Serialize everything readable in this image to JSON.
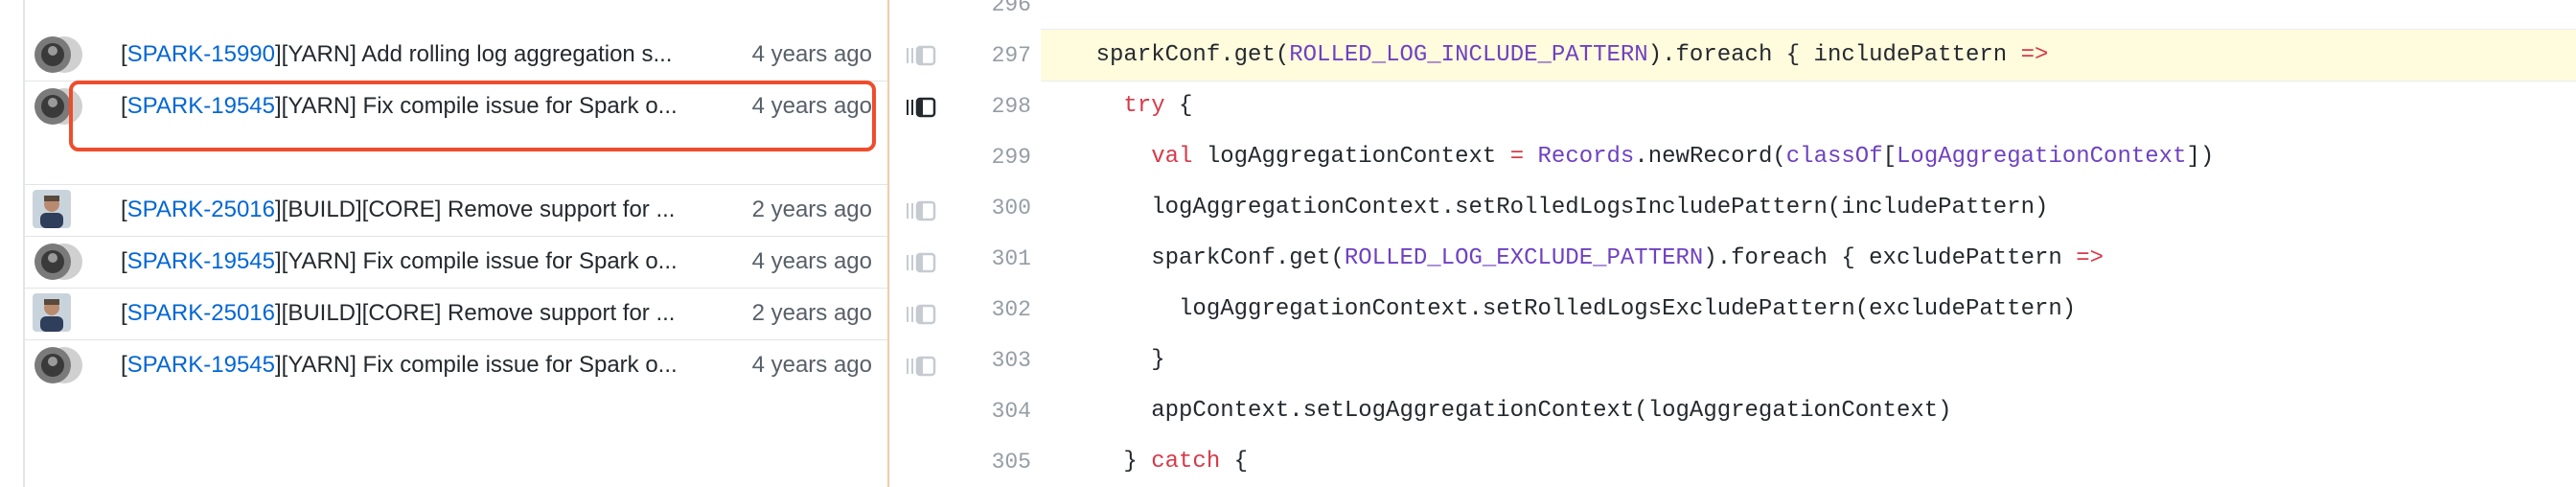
{
  "blame": {
    "rows": [
      {
        "avatar": "avatar-gray",
        "ref": "SPARK-15990",
        "msg": "[YARN] Add rolling log aggregation s...",
        "age": "4 years ago"
      },
      {
        "avatar": "avatar-gray",
        "ref": "SPARK-19545",
        "msg": "[YARN] Fix compile issue for Spark o...",
        "age": "4 years ago"
      },
      {
        "avatar": "avatar-photo",
        "ref": "SPARK-25016",
        "msg": "[BUILD][CORE] Remove support for ...",
        "age": "2 years ago"
      },
      {
        "avatar": "avatar-gray",
        "ref": "SPARK-19545",
        "msg": "[YARN] Fix compile issue for Spark o...",
        "age": "4 years ago"
      },
      {
        "avatar": "avatar-photo",
        "ref": "SPARK-25016",
        "msg": "[BUILD][CORE] Remove support for ...",
        "age": "2 years ago"
      },
      {
        "avatar": "avatar-gray",
        "ref": "SPARK-19545",
        "msg": "[YARN] Fix compile issue for Spark o...",
        "age": "4 years ago"
      }
    ]
  },
  "code": {
    "line_numbers": [
      "296",
      "297",
      "298",
      "299",
      "300",
      "301",
      "302",
      "303",
      "304",
      "305"
    ],
    "lines": [
      "",
      "    sparkConf.get(ROLLED_LOG_INCLUDE_PATTERN).foreach { includePattern =>",
      "      try {",
      "        val logAggregationContext = Records.newRecord(classOf[LogAggregationContext])",
      "        logAggregationContext.setRolledLogsIncludePattern(includePattern)",
      "        sparkConf.get(ROLLED_LOG_EXCLUDE_PATTERN).foreach { excludePattern =>",
      "          logAggregationContext.setRolledLogsExcludePattern(excludePattern)",
      "        }",
      "        appContext.setLogAggregationContext(logAggregationContext)",
      "      } catch {"
    ],
    "highlighted_line": "297"
  },
  "colors": {
    "highlight_border": "#ee4d2d",
    "link": "#0366d6",
    "keyword": "#d73a49",
    "constant": "#6f42c1",
    "line_highlight": "#fffbdd"
  }
}
